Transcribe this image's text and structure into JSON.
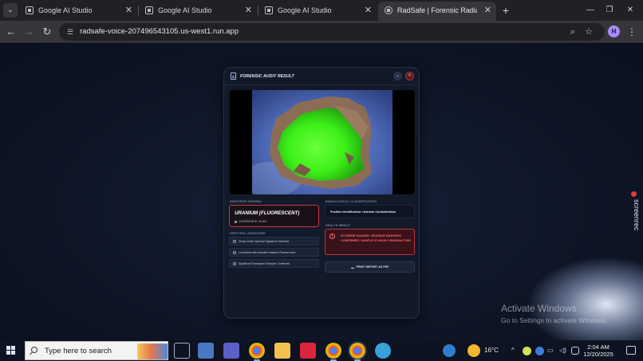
{
  "browser": {
    "tabs": [
      {
        "title": "Google AI Studio",
        "active": false
      },
      {
        "title": "Google AI Studio",
        "active": false
      },
      {
        "title": "Google AI Studio",
        "active": false
      },
      {
        "title": "RadSafe | Forensic Radiation An",
        "active": true
      }
    ],
    "url": "radsafe-voice-207496543105.us-west1.run.app",
    "profile_initial": "H"
  },
  "modal": {
    "title": "FORENSIC AUDIT RESULT",
    "labels": {
      "identification": "IDENTIFIED MINERAL",
      "signatures": "SPECTRAL SIGNATURE",
      "classification": "RADIOLOGICAL CLASSIFICATION",
      "impact": "HEALTH IMPACT"
    },
    "mineral": "URANIUM (FLUORESCENT)",
    "confidence": "CONFIDENCE: 99.8%",
    "signatures": [
      "Sharp Green Spectral Signature Detected",
      "Consistent with Autunite Uranium Fluorescence",
      "Significant Shortwave Emission Confirmed"
    ],
    "classification": "Positive Identification: Uranium Contamination",
    "impact_text": "EXTREME HAZARD: URANIUM MARKERS CONFIRMED. SAMPLE IS HIGHLY RADIOACTIVE.",
    "print_label": "PRINT REPORT AS PDF"
  },
  "overlay": {
    "screenrec": "screenrec",
    "activate_title": "Activate Windows",
    "activate_sub": "Go to Settings to activate Windows."
  },
  "taskbar": {
    "search_placeholder": "Type here to search",
    "temperature": "16°C",
    "time": "2:04 AM",
    "date": "12/20/2025"
  },
  "colors": {
    "accent_red": "#c43a47",
    "fluorescent_green": "#39ff14",
    "modal_bg": "#121a2a"
  },
  "icons": [
    "chevron-down-icon",
    "close-icon",
    "document-icon",
    "warning-icon",
    "download-icon",
    "search-icon",
    "star-icon",
    "windows-start-icon"
  ]
}
